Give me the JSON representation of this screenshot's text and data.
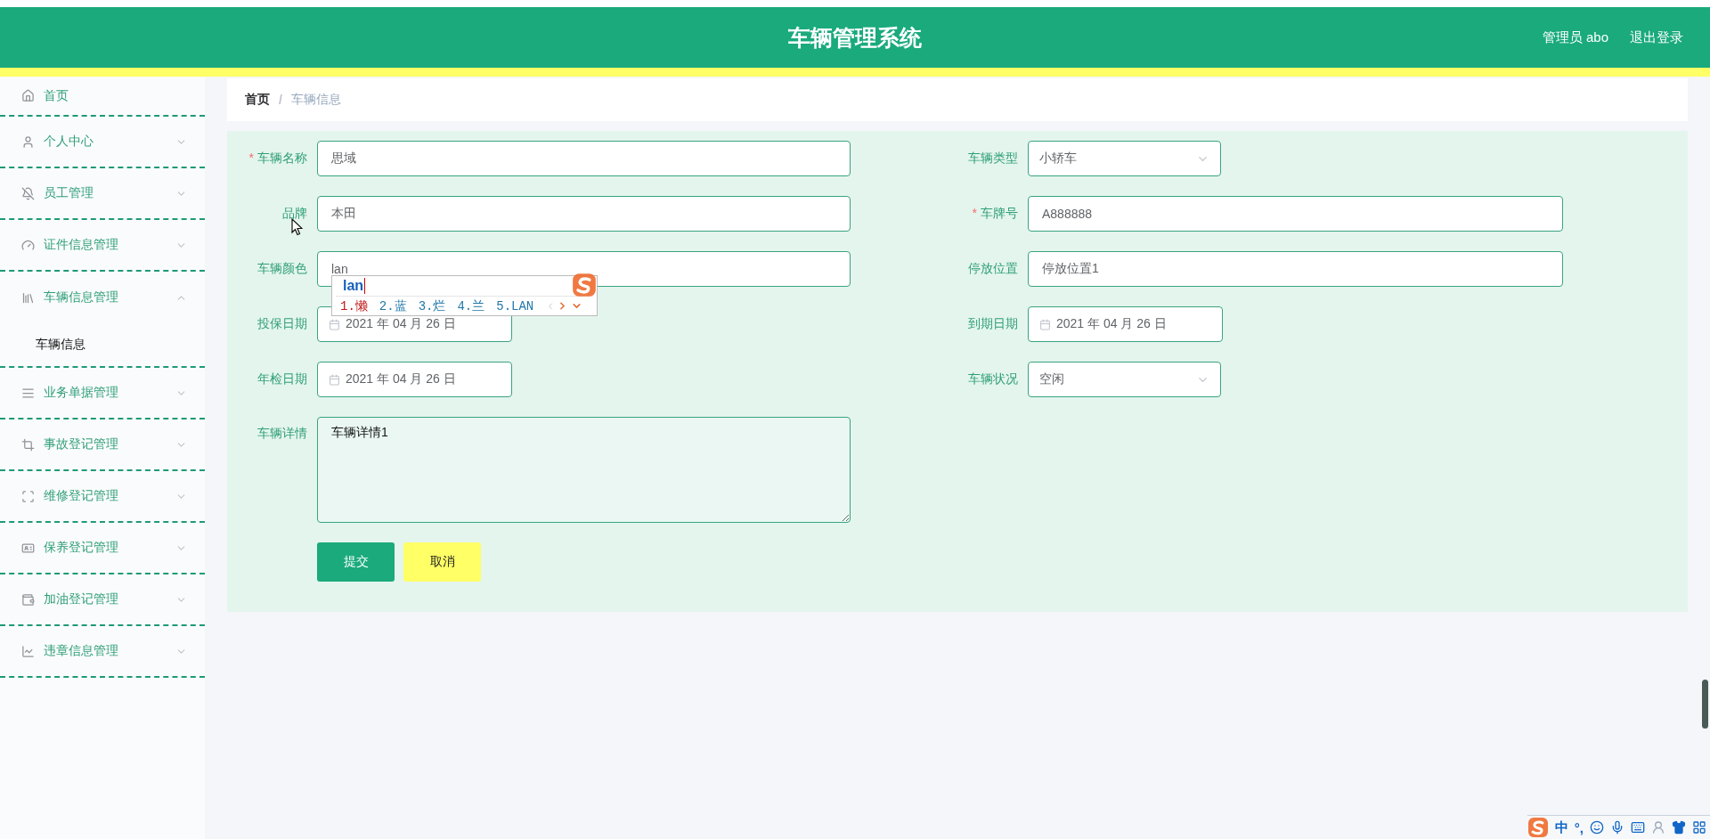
{
  "header": {
    "title": "车辆管理系统",
    "user": "管理员 abo",
    "logout": "退出登录"
  },
  "sidebar": {
    "items": [
      {
        "label": "首页",
        "kind": "link"
      },
      {
        "label": "个人中心",
        "kind": "menu",
        "expanded": false
      },
      {
        "label": "员工管理",
        "kind": "menu",
        "expanded": false
      },
      {
        "label": "证件信息管理",
        "kind": "menu",
        "expanded": false
      },
      {
        "label": "车辆信息管理",
        "kind": "menu",
        "expanded": true,
        "children": [
          {
            "label": "车辆信息"
          }
        ]
      },
      {
        "label": "业务单据管理",
        "kind": "menu",
        "expanded": false
      },
      {
        "label": "事故登记管理",
        "kind": "menu",
        "expanded": false
      },
      {
        "label": "维修登记管理",
        "kind": "menu",
        "expanded": false
      },
      {
        "label": "保养登记管理",
        "kind": "menu",
        "expanded": false
      },
      {
        "label": "加油登记管理",
        "kind": "menu",
        "expanded": false
      },
      {
        "label": "违章信息管理",
        "kind": "menu",
        "expanded": false
      }
    ]
  },
  "breadcrumb": [
    {
      "label": "首页",
      "selected": false
    },
    {
      "label": "/",
      "kind": "separator"
    },
    {
      "label": "车辆信息",
      "selected": true
    }
  ],
  "form": {
    "left": [
      {
        "label": "车辆名称",
        "required_mark": "*",
        "kind": "text",
        "value": "思域"
      },
      {
        "label": "品牌",
        "kind": "text",
        "value": "本田"
      },
      {
        "label": "车辆颜色",
        "kind": "text",
        "value": "lan",
        "ime": true
      },
      {
        "label": "投保日期",
        "kind": "date",
        "value": "2021 年 04 月 26 日"
      },
      {
        "label": "年检日期",
        "kind": "date",
        "value": "2021 年 04 月 26 日"
      },
      {
        "label": "车辆详情",
        "kind": "textarea",
        "value": "车辆详情1"
      }
    ],
    "right": [
      {
        "label": "车辆类型",
        "kind": "select",
        "value": "小轿车"
      },
      {
        "label": "车牌号",
        "required_mark": "*",
        "kind": "text",
        "value": "A888888"
      },
      {
        "label": "停放位置",
        "kind": "text",
        "value": "停放位置1"
      },
      {
        "label": "到期日期",
        "kind": "date",
        "value": "2021 年 04 月 26 日"
      },
      {
        "label": "车辆状况",
        "kind": "select",
        "value": "空闲"
      }
    ],
    "buttons": [
      {
        "label": "提交",
        "kind": "primary"
      },
      {
        "label": "取消",
        "kind": "cancel"
      }
    ]
  },
  "ime_popup": {
    "composition": "lan",
    "candidates": [
      {
        "label": "1.懒",
        "selected": true
      },
      {
        "label": "2.蓝",
        "selected": false
      },
      {
        "label": "3.烂",
        "selected": false
      },
      {
        "label": "4.兰",
        "selected": false
      },
      {
        "label": "5.LAN",
        "selected": false
      }
    ]
  },
  "ime_toolbar": {
    "mode": "中",
    "punctuation": "°,"
  }
}
